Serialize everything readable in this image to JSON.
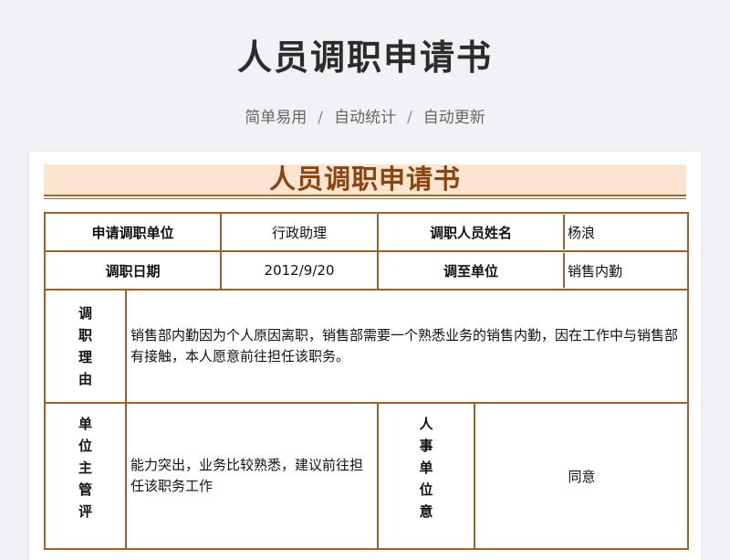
{
  "header": {
    "title": "人员调职申请书",
    "tags": [
      "简单易用",
      "自动统计",
      "自动更新"
    ],
    "separator": "/"
  },
  "document": {
    "title": "人员调职申请书",
    "row1": {
      "apply_unit_label": "申请调职单位",
      "apply_unit_value": "行政助理",
      "person_name_label": "调职人员姓名",
      "person_name_value": "杨浪"
    },
    "row2": {
      "date_label": "调职日期",
      "date_value": "2012/9/20",
      "target_unit_label": "调至单位",
      "target_unit_value": "销售内勤"
    },
    "reason": {
      "label_chars": [
        "调",
        "职",
        "理",
        "由"
      ],
      "text": "销售部内勤因为个人原因离职，销售部需要一个熟悉业务的销售内勤，因在工作中与销售部有接触，本人愿意前往担任该职务。"
    },
    "supervisor": {
      "label_chars": [
        "单",
        "位",
        "主",
        "管",
        "评"
      ],
      "text": "能力突出，业务比较熟悉，建议前往担任该职务工作"
    },
    "hr": {
      "label_chars": [
        "人",
        "事",
        "单",
        "位",
        "意"
      ],
      "text": "同意"
    }
  }
}
